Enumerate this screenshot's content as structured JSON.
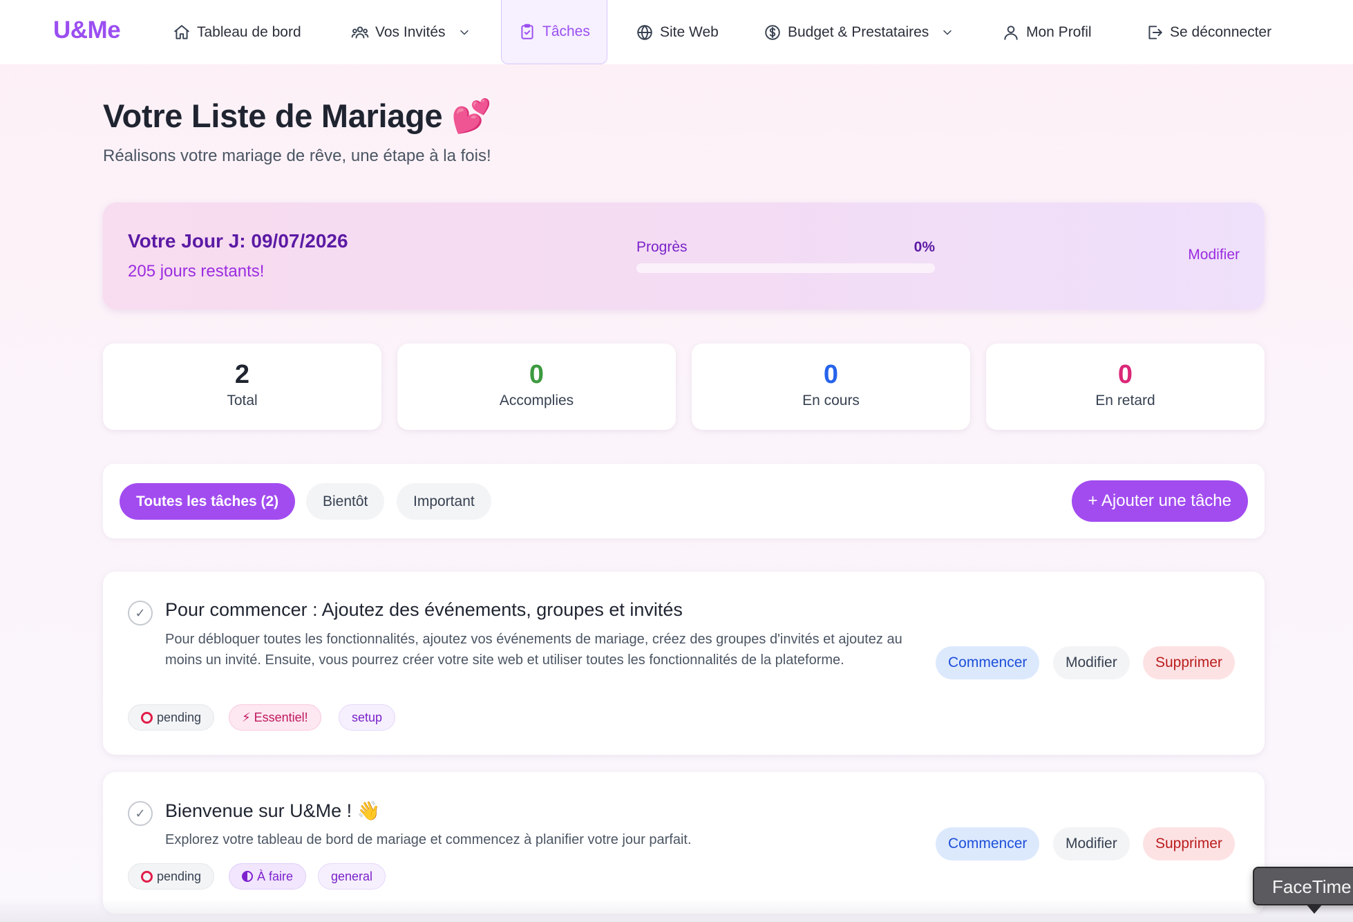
{
  "nav": {
    "logo": "U&Me",
    "items": [
      {
        "label": "Tableau de bord",
        "icon": "home-icon"
      },
      {
        "label": "Vos Invités",
        "icon": "users-icon",
        "dropdown": true
      },
      {
        "label": "Tâches",
        "icon": "clipboard-check-icon",
        "active": true
      },
      {
        "label": "Site Web",
        "icon": "globe-icon"
      },
      {
        "label": "Budget & Prestataires",
        "icon": "dollar-icon",
        "dropdown": true
      },
      {
        "label": "Mon Profil",
        "icon": "user-icon"
      },
      {
        "label": "Se déconnecter",
        "icon": "logout-icon"
      }
    ]
  },
  "page": {
    "title": "Votre Liste de Mariage 💕",
    "subtitle": "Réalisons votre mariage de rêve, une étape à la fois!"
  },
  "countdown": {
    "date_label": "Votre Jour J: 09/07/2026",
    "days_left": "205 jours restants!",
    "progress_label": "Progrès",
    "progress_value": "0%",
    "progress_fraction": 0,
    "edit_label": "Modifier"
  },
  "stats": [
    {
      "value": "2",
      "label": "Total",
      "color": "#1f2430"
    },
    {
      "value": "0",
      "label": "Accomplies",
      "color": "#3d9a3f"
    },
    {
      "value": "0",
      "label": "En cours",
      "color": "#2563eb"
    },
    {
      "value": "0",
      "label": "En retard",
      "color": "#db2777"
    }
  ],
  "filters": {
    "tabs": [
      "Toutes les tâches (2)",
      "Bientôt",
      "Important"
    ],
    "active_index": 0,
    "add_label": "+ Ajouter une tâche"
  },
  "tasks": [
    {
      "title": "Pour commencer : Ajoutez des événements, groupes et invités",
      "description": "Pour débloquer toutes les fonctionnalités, ajoutez vos événements de mariage, créez des groupes d'invités et ajoutez au moins un invité. Ensuite, vous pourrez créer votre site web et utiliser toutes les fonctionnalités de la plateforme.",
      "status": "pending",
      "priority": "⚡ Essentiel!",
      "category": "setup",
      "actions": {
        "start": "Commencer",
        "edit": "Modifier",
        "delete": "Supprimer"
      }
    },
    {
      "title": "Bienvenue sur U&Me ! 👋",
      "description": "Explorez votre tableau de bord de mariage et commencez à planifier votre jour parfait.",
      "status": "pending",
      "priority": "À faire",
      "category": "general",
      "actions": {
        "start": "Commencer",
        "edit": "Modifier",
        "delete": "Supprimer"
      }
    }
  ],
  "overlay": {
    "facetime_label": "FaceTime"
  },
  "colors": {
    "accent": "#a24cf0",
    "logo": "#9b4ef0"
  }
}
